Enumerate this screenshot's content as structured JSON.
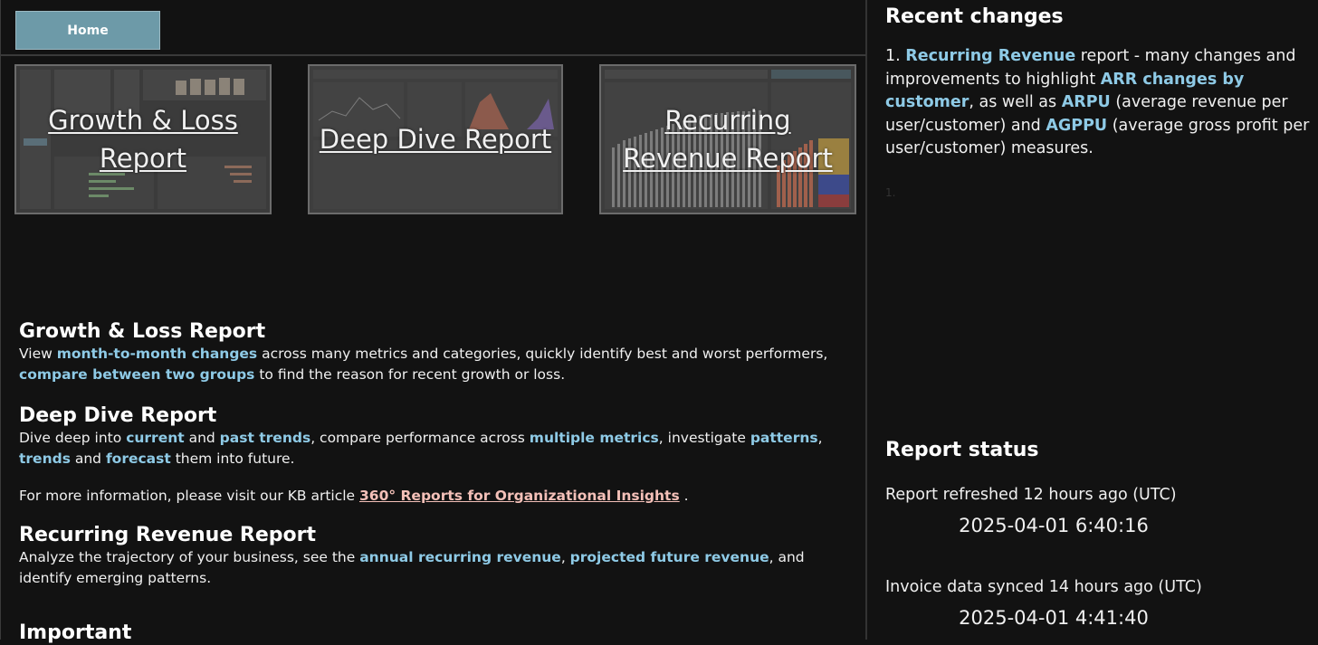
{
  "nav": {
    "home_label": "Home"
  },
  "tiles": [
    {
      "label": "Growth & Loss Report"
    },
    {
      "label": "Deep Dive Report"
    },
    {
      "label": "Recurring Revenue Report"
    }
  ],
  "sections": {
    "growth": {
      "title": "Growth & Loss Report",
      "t1": "View ",
      "h1": "month-to-month changes",
      "t2": " across many metrics and categories, quickly identify best and worst performers, ",
      "h2": "compare between two groups",
      "t3": " to find the reason for recent growth or loss."
    },
    "deep": {
      "title": "Deep Dive Report",
      "t1": "Dive deep into ",
      "h1": "current",
      "t2": " and ",
      "h2": "past trends",
      "t3": ", compare performance across ",
      "h3": "multiple metrics",
      "t4": ", investigate ",
      "h4": "patterns",
      "t5": ", ",
      "h5": "trends",
      "t6": " and ",
      "h6": "forecast",
      "t7": " them into future."
    },
    "kb": {
      "t1": "For more information, please visit our KB article ",
      "link": "360° Reports for Organizational Insights",
      "t2": " ."
    },
    "recurring": {
      "title": "Recurring Revenue Report",
      "t1": "Analyze the trajectory of your business, see the ",
      "h1": "annual recurring revenue",
      "t2": ", ",
      "h2": "projected future revenue",
      "t3": ", and identify emerging patterns."
    },
    "important": {
      "title": "Important"
    }
  },
  "recent_changes": {
    "title": "Recent changes",
    "item1": {
      "num": "1. ",
      "h1": "Recurring Revenue",
      "t1": " report - many changes and improvements to highlight ",
      "h2": "ARR changes by customer",
      "t2": ", as well as ",
      "h3": "ARPU",
      "t3": " (average revenue per user/customer) and ",
      "h4": "AGPPU",
      "t4": " (average gross profit per user/customer) measures."
    },
    "item2_num": "1."
  },
  "report_status": {
    "title": "Report status",
    "refreshed_label": "Report refreshed 12 hours ago (UTC)",
    "refreshed_time": "2025-04-01 6:40:16",
    "synced_label": "Invoice data synced 14 hours ago (UTC)",
    "synced_time": "2025-04-01 4:41:40"
  },
  "colors": {
    "background": "#121212",
    "highlight": "#8ecae6",
    "link": "#f4c0b8",
    "home_button": "#6d9aa8"
  }
}
